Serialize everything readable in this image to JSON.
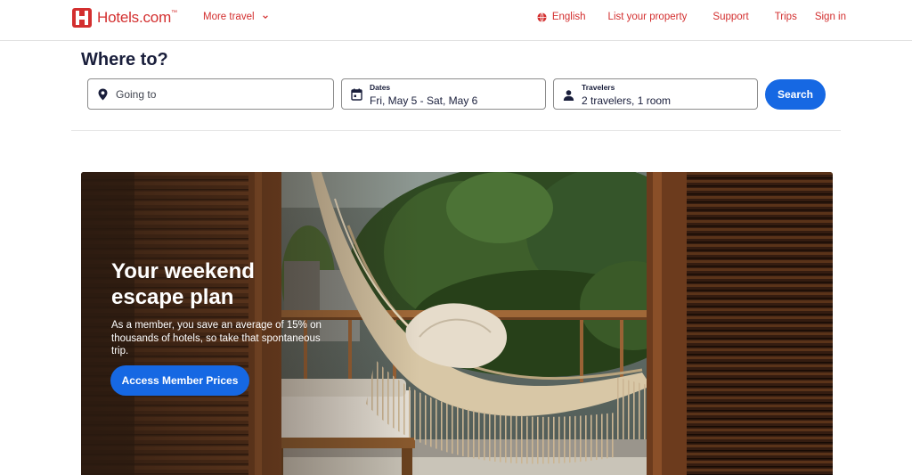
{
  "header": {
    "logo_text": "Hotels.com",
    "logo_tm": "™",
    "more_travel": "More travel",
    "language": "English",
    "list_property": "List your property",
    "support": "Support",
    "trips": "Trips",
    "sign_in": "Sign in"
  },
  "search": {
    "title": "Where to?",
    "going_to": "Going to",
    "dates_label": "Dates",
    "dates_value": "Fri, May 5 - Sat, May 6",
    "travelers_label": "Travelers",
    "travelers_value": "2 travelers, 1 room",
    "search_button": "Search"
  },
  "hero": {
    "title": "Your weekend escape plan",
    "subtitle": "As a member, you save an average of 15% on thousands of hotels, so take that spontaneous trip.",
    "button": "Access Member Prices"
  },
  "colors": {
    "brand_red": "#d32f2f",
    "primary_blue": "#1668e3"
  },
  "icons": [
    "hotels-logo-icon",
    "chevron-down-icon",
    "globe-icon",
    "location-pin-icon",
    "calendar-icon",
    "person-icon"
  ]
}
